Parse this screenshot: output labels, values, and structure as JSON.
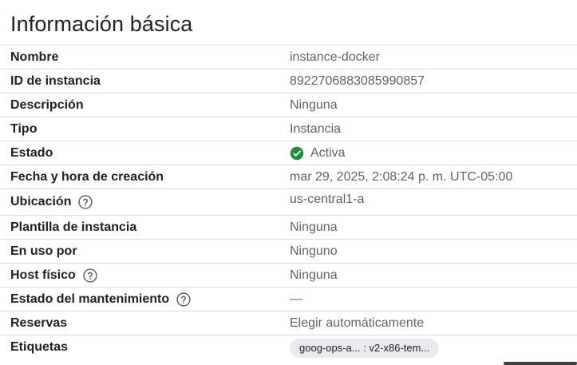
{
  "section": {
    "title": "Información básica"
  },
  "rows": [
    {
      "label": "Nombre",
      "value": "instance-docker"
    },
    {
      "label": "ID de instancia",
      "value": "8922706883085990857"
    },
    {
      "label": "Descripción",
      "value": "Ninguna"
    },
    {
      "label": "Tipo",
      "value": "Instancia"
    },
    {
      "label": "Estado",
      "value": "Activa"
    },
    {
      "label": "Fecha y hora de creación",
      "value": "mar 29, 2025, 2:08:24 p. m. UTC-05:00"
    },
    {
      "label": "Ubicación",
      "value": "us-central1-a"
    },
    {
      "label": "Plantilla de instancia",
      "value": "Ninguna"
    },
    {
      "label": "En uso por",
      "value": "Ninguno"
    },
    {
      "label": "Host físico",
      "value": "Ninguna"
    },
    {
      "label": "Estado del mantenimiento",
      "value": "—"
    },
    {
      "label": "Reservas",
      "value": "Elegir automáticamente"
    },
    {
      "label": "Etiquetas",
      "value": "goog-ops-a... : v2-x86-tem..."
    }
  ],
  "icons": {
    "help": "help-circle-icon",
    "status": "check-circle-icon"
  },
  "colors": {
    "status_green": "#1e8e3e",
    "divider": "#dadce0",
    "chip_bg": "#e8eaed"
  }
}
